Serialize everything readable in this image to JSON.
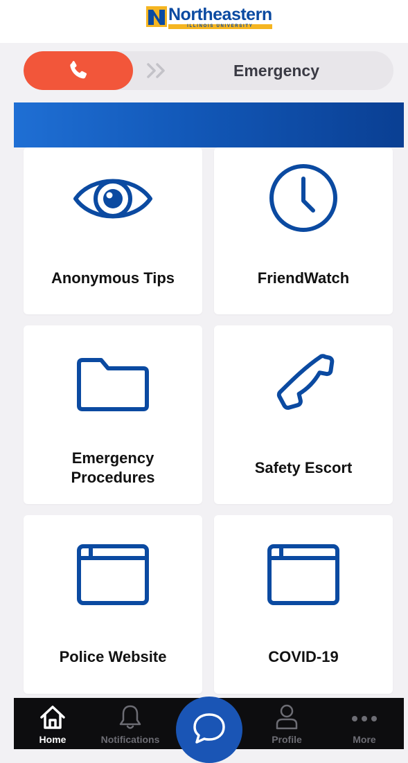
{
  "app": {
    "logo_text": "Northeastern",
    "logo_subtext": "ILLINOIS UNIVERSITY",
    "brand_color": "#0b4aa1",
    "accent_color": "#f2563a"
  },
  "emergency_slider": {
    "label": "Emergency",
    "knob_icon": "phone-icon",
    "arrows_icon": "double-chevron-right-icon"
  },
  "tiles": [
    {
      "label": "Anonymous Tips",
      "icon": "eye-icon"
    },
    {
      "label": "FriendWatch",
      "icon": "clock-icon"
    },
    {
      "label": "Emergency Procedures",
      "icon": "folder-icon"
    },
    {
      "label": "Safety Escort",
      "icon": "phone-icon"
    },
    {
      "label": "Police Website",
      "icon": "browser-window-icon"
    },
    {
      "label": "COVID-19",
      "icon": "browser-window-icon"
    }
  ],
  "tabbar": {
    "items": [
      {
        "label": "Home",
        "icon": "home-icon",
        "active": true
      },
      {
        "label": "Notifications",
        "icon": "bell-icon",
        "active": false
      },
      {
        "label": "",
        "icon": "chat-bubble-icon",
        "active": false
      },
      {
        "label": "Profile",
        "icon": "person-icon",
        "active": false
      },
      {
        "label": "More",
        "icon": "ellipsis-icon",
        "active": false
      }
    ]
  }
}
